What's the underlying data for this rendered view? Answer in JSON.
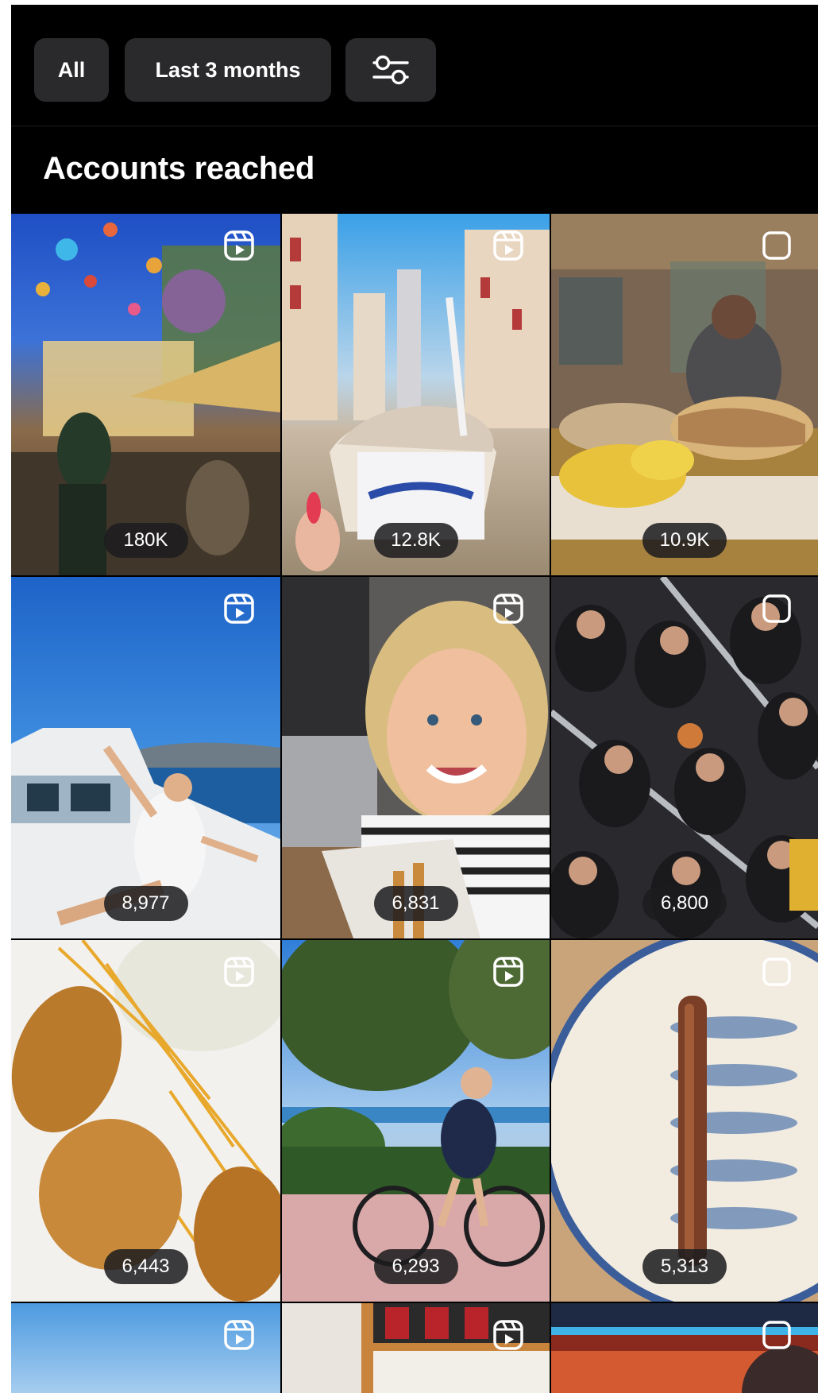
{
  "filters": {
    "all_label": "All",
    "period_label": "Last 3 months",
    "options_icon": "sliders-icon"
  },
  "section": {
    "title": "Accounts reached"
  },
  "posts": [
    {
      "reach": "180K",
      "type": "reel",
      "subject": "Festive street with lanterns and outdoor café"
    },
    {
      "reach": "12.8K",
      "type": "reel",
      "subject": "Ice cream cup held on city street"
    },
    {
      "reach": "10.9K",
      "type": "post",
      "subject": "Sandwich and chips at a bar counter"
    },
    {
      "reach": "8,977",
      "type": "reel",
      "subject": "Woman posing on yacht deck by the sea"
    },
    {
      "reach": "6,831",
      "type": "reel",
      "subject": "Smiling woman selfie with churros"
    },
    {
      "reach": "6,800",
      "type": "post",
      "subject": "Procession crowd seen from above"
    },
    {
      "reach": "6,443",
      "type": "reel",
      "subject": "Croquettes with fries and sauce"
    },
    {
      "reach": "6,293",
      "type": "reel",
      "subject": "Woman riding a bicycle on promenade"
    },
    {
      "reach": "5,313",
      "type": "post",
      "subject": "Anchovy on a fish-pattern plate"
    },
    {
      "reach": "",
      "type": "reel",
      "subject": "Sky over beach"
    },
    {
      "reach": "",
      "type": "reel",
      "subject": "Shelf with sauce bottles"
    },
    {
      "reach": "",
      "type": "post",
      "subject": "Neon lit interior"
    }
  ],
  "colors": {
    "background": "#000000",
    "chip": "#2a2a2c",
    "text": "#ffffff",
    "badge": "#1c1c1e"
  }
}
